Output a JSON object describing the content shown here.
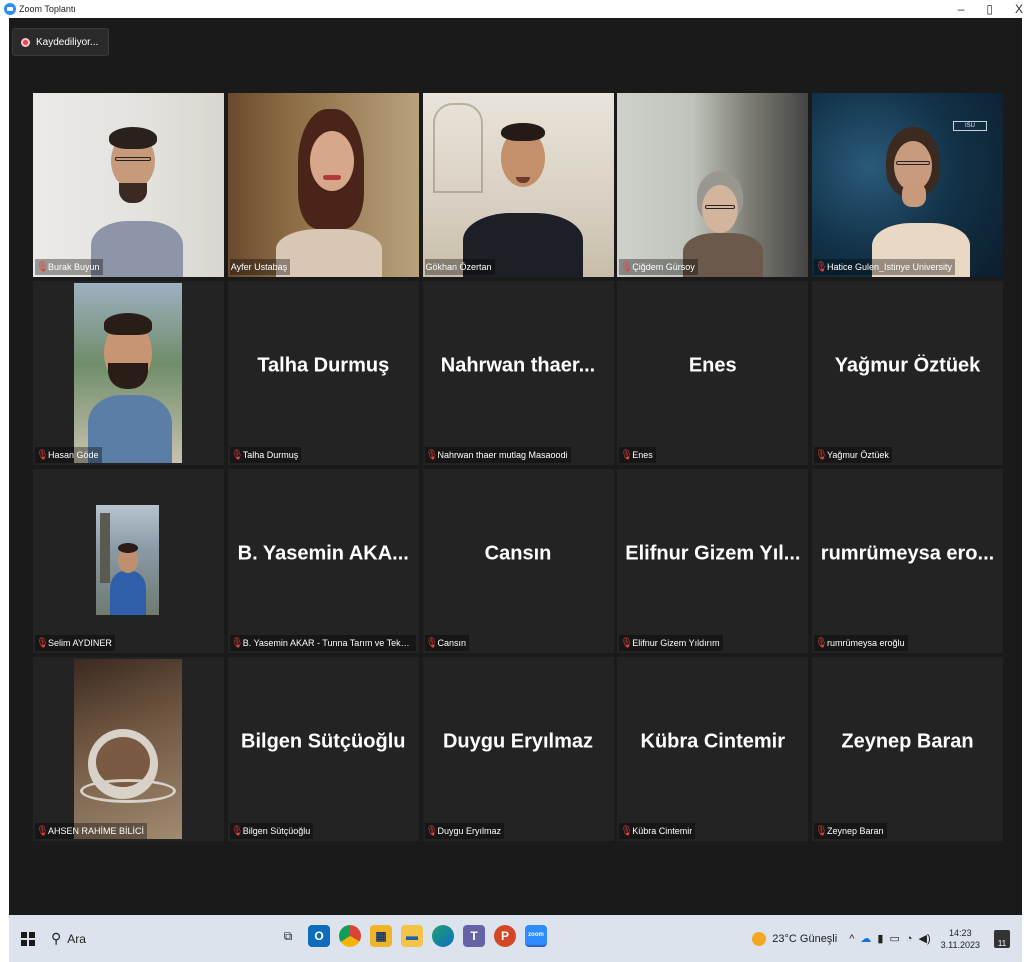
{
  "window": {
    "title": "Zoom Toplantı",
    "controls": {
      "minimize": "–",
      "restore": "▯",
      "close": "X"
    }
  },
  "meeting": {
    "recording_label": "Kaydediliyor..."
  },
  "participants": [
    {
      "name": "Burak Buyun",
      "video": true,
      "muted": true
    },
    {
      "name": "Ayfer Ustabaş",
      "video": true,
      "muted": false
    },
    {
      "name": "Gökhan Özertan",
      "video": true,
      "muted": false,
      "active_speaker": true
    },
    {
      "name": "Çiğdem Gürsoy",
      "video": true,
      "muted": true
    },
    {
      "name": "Hatice Gulen_Istinye University",
      "video": true,
      "muted": true
    },
    {
      "name": "Hasan Göde",
      "video": true,
      "muted": true
    },
    {
      "display": "Talha Durmuş",
      "name": "Talha Durmuş",
      "video": false,
      "muted": true
    },
    {
      "display": "Nahrwan thaer...",
      "name": "Nahrwan thaer mutlag Masaoodi",
      "video": false,
      "muted": true
    },
    {
      "display": "Enes",
      "name": "Enes",
      "video": false,
      "muted": true
    },
    {
      "display": "Yağmur Öztüek",
      "name": "Yağmur Öztüek",
      "video": false,
      "muted": true
    },
    {
      "name": "Selim AYDINER",
      "video": true,
      "muted": true
    },
    {
      "display": "B. Yasemin AKA...",
      "name": "B. Yasemin AKAR - Tunna Tarım ve Teknoloji A...",
      "video": false,
      "muted": true
    },
    {
      "display": "Cansın",
      "name": "Cansın",
      "video": false,
      "muted": true
    },
    {
      "display": "Elifnur Gizem Yıl...",
      "name": "Elifnur Gizem Yıldırım",
      "video": false,
      "muted": true
    },
    {
      "display": "rumrümeysa ero...",
      "name": "rumrümeysa eroğlu",
      "video": false,
      "muted": true
    },
    {
      "name": "AHSEN RAHİME BİLİCİ",
      "video": true,
      "muted": true
    },
    {
      "display": "Bilgen Sütçüoğlu",
      "name": "Bilgen Sütçüoğlu",
      "video": false,
      "muted": true
    },
    {
      "display": "Duygu Eryılmaz",
      "name": "Duygu Eryılmaz",
      "video": false,
      "muted": true
    },
    {
      "display": "Kübra Cintemir",
      "name": "Kübra Cintemir",
      "video": false,
      "muted": true
    },
    {
      "display": "Zeynep Baran",
      "name": "Zeynep Baran",
      "video": false,
      "muted": true
    }
  ],
  "taskbar": {
    "search_placeholder": "Ara",
    "weather": "23°C Güneşli",
    "time": "14:23",
    "date": "3.11.2023",
    "notification_count": "11"
  },
  "colors": {
    "active_speaker_border": "#d8f26a",
    "muted_icon": "#e0423a",
    "tile_bg": "#232323"
  }
}
